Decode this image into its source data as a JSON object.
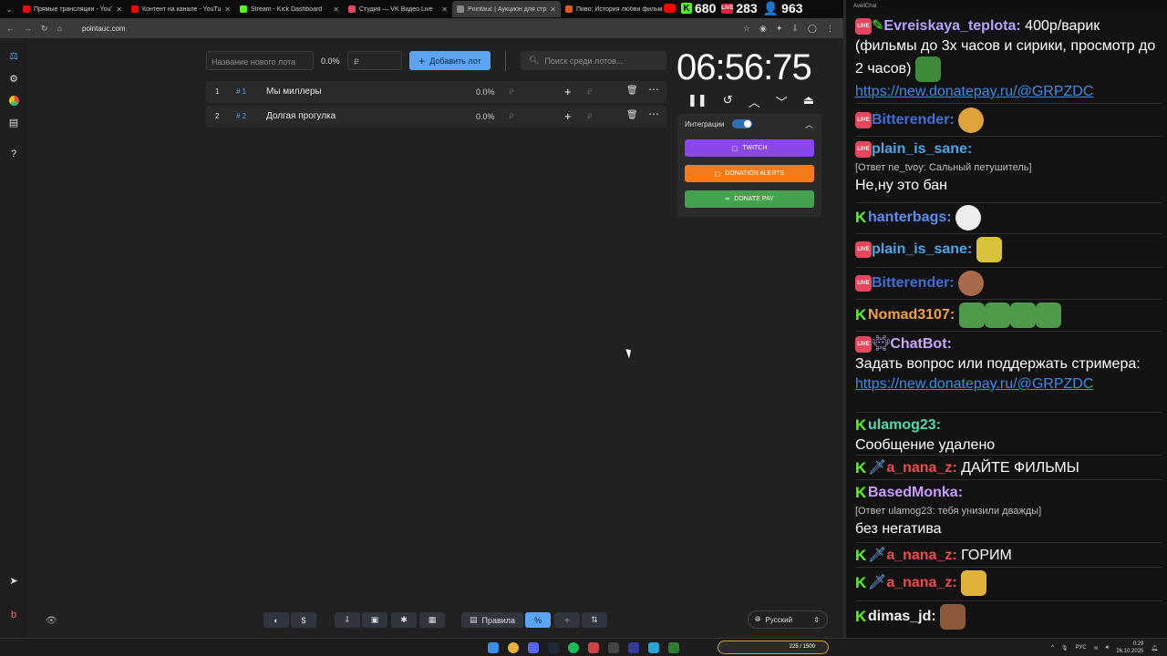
{
  "tabs": [
    {
      "title": "Прямые трансляции - YouTube",
      "color": "#ff0000"
    },
    {
      "title": "Контент на канале - YouTube",
      "color": "#ff0000"
    },
    {
      "title": "Stream - Kick Dashboard",
      "color": "#53fc18"
    },
    {
      "title": "Студия — VK Видео Live",
      "color": "#e5485e"
    },
    {
      "title": "Pointauc | Аукцион для стрима",
      "color": "#888888"
    },
    {
      "title": "Пиво: История любви фильм",
      "color": "#e05a1f"
    }
  ],
  "stats": {
    "kick": "680",
    "vk": "283",
    "viewers": "963"
  },
  "address": {
    "url": "pointauc.com"
  },
  "lot_form": {
    "name_placeholder": "Название нового лота",
    "percent": "0.0%",
    "currency_placeholder": "₽",
    "add_label": "Добавить лот",
    "search_placeholder": "Поиск среди лотов..."
  },
  "lots": [
    {
      "idx": "1",
      "hash": "# 1",
      "name": "Мы миллеры",
      "percent": "0.0%",
      "cur": "₽"
    },
    {
      "idx": "2",
      "hash": "# 2",
      "name": "Долгая прогулка",
      "percent": "0.0%",
      "cur": "₽"
    }
  ],
  "timer": {
    "value": "06:56:75"
  },
  "integrations": {
    "title": "Интеграции",
    "twitch": "TWITCH",
    "donation_alerts": "DONATION ALERTS",
    "donatepay": "DONATE PAY",
    "colors": {
      "twitch": "#8a46e8",
      "da": "#f27a18",
      "dp": "#43a24d"
    }
  },
  "footer": {
    "rules": "Правила",
    "language": "Русский"
  },
  "chat": {
    "window_title": "AveliChat",
    "messages": [
      {
        "src": "live",
        "user": "Evreiskaya_teplota:",
        "color": "#b7a0ff",
        "text": "400р/варик (фильмы до 3х часов и сирики, просмотр до 2 часов)",
        "link": "https://new.donatepay.ru/@GRPZDC"
      },
      {
        "src": "live",
        "user": "Bitterender:",
        "color": "#3f6ed8"
      },
      {
        "src": "live",
        "user": "plain_is_sane:",
        "color": "#4aa6e8",
        "reply": "[Ответ ne_tvoy: Сальный петушитель]",
        "text": "Не,ну это бан"
      },
      {
        "src": "kick",
        "user": "hanterbags:",
        "color": "#5b8cf0"
      },
      {
        "src": "live",
        "user": "plain_is_sane:",
        "color": "#4aa6e8"
      },
      {
        "src": "live",
        "user": "Bitterender:",
        "color": "#3f6ed8"
      },
      {
        "src": "kick",
        "user": "Nomad3107:",
        "color": "#f2a23a"
      },
      {
        "src": "live",
        "user": "ChatBot:",
        "color": "#c7a6ff",
        "text": "Задать вопрос или поддержать стримера:",
        "link": "https://new.donatepay.ru/@GRPZDC"
      },
      {
        "src": "kick",
        "user": "ulamog23:",
        "color": "#4dd9b0",
        "text": "Сообщение удалено"
      },
      {
        "src": "kick",
        "user": "a_nana_z:",
        "color": "#f04a4a",
        "text": "ДАЙТЕ ФИЛЬМЫ"
      },
      {
        "src": "kick",
        "user": "BasedMonka:",
        "color": "#c79cff",
        "reply": "[Ответ ulamog23: тебя унизили дважды]",
        "text": "без негатива"
      },
      {
        "src": "kick",
        "user": "a_nana_z:",
        "color": "#f04a4a",
        "text": "ГОРИМ"
      },
      {
        "src": "kick",
        "user": "a_nana_z:",
        "color": "#f04a4a"
      },
      {
        "src": "kick",
        "user": "dimas_jd:",
        "color": "#f2f2f2"
      }
    ]
  },
  "taskbar": {
    "lang": "РУС",
    "time": "0:29",
    "date": "26.10.2025",
    "widget": "225 / 1500"
  }
}
